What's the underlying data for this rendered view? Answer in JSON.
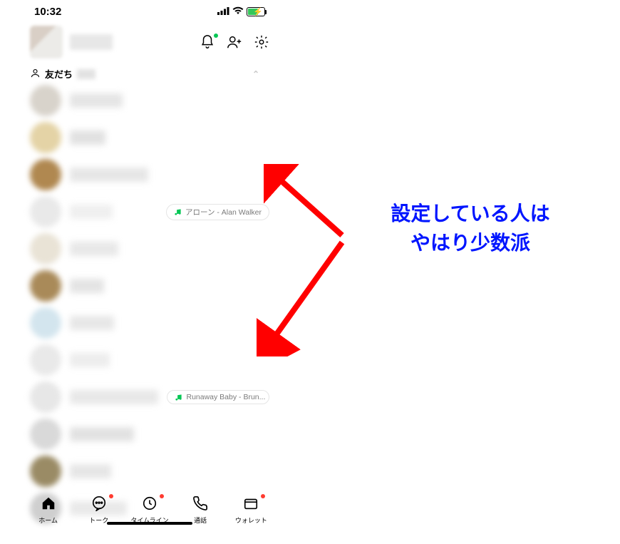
{
  "status": {
    "time": "10:32"
  },
  "header": {
    "icons": {
      "bell": "bell-icon",
      "addFriend": "add-friend-icon",
      "gear": "gear-icon"
    }
  },
  "section": {
    "label": "友だち"
  },
  "friends": [
    {
      "avatarColor": "#d8d3cb",
      "nameW": 74,
      "nameColor": "#e5e5e5"
    },
    {
      "avatarColor": "#e4d3a6",
      "nameW": 50,
      "nameColor": "#e1e1e1"
    },
    {
      "avatarColor": "#b08850",
      "nameW": 110,
      "nameColor": "#e6e6e6"
    },
    {
      "avatarColor": "#e9e9e9",
      "nameW": 60,
      "nameColor": "#efefef",
      "music": "アローン - Alan Walker"
    },
    {
      "avatarColor": "#e9e3d6",
      "nameW": 68,
      "nameColor": "#e8e8e8"
    },
    {
      "avatarColor": "#a98a59",
      "nameW": 48,
      "nameColor": "#e4e4e4"
    },
    {
      "avatarColor": "#d3e5ee",
      "nameW": 62,
      "nameColor": "#e7e7e7"
    },
    {
      "avatarColor": "#e9e9e9",
      "nameW": 56,
      "nameColor": "#ededed"
    },
    {
      "avatarColor": "#e7e7e7",
      "nameW": 130,
      "nameColor": "#e8e8e8",
      "music": "Runaway Baby - Brun..."
    },
    {
      "avatarColor": "#d9d9d9",
      "nameW": 90,
      "nameColor": "#e2e2e2"
    },
    {
      "avatarColor": "#9a8b65",
      "nameW": 58,
      "nameColor": "#e6e6e6"
    },
    {
      "avatarColor": "#cfcfcf",
      "nameW": 80,
      "nameColor": "#e9e9e9"
    }
  ],
  "tabs": [
    {
      "id": "home",
      "label": "ホーム",
      "active": true
    },
    {
      "id": "talk",
      "label": "トーク",
      "dot": true
    },
    {
      "id": "timeline",
      "label": "タイムライン",
      "dot": true
    },
    {
      "id": "call",
      "label": "通話"
    },
    {
      "id": "wallet",
      "label": "ウォレット",
      "dot": true
    }
  ],
  "annotation": {
    "line1": "設定している人は",
    "line2": "やはり少数派"
  }
}
